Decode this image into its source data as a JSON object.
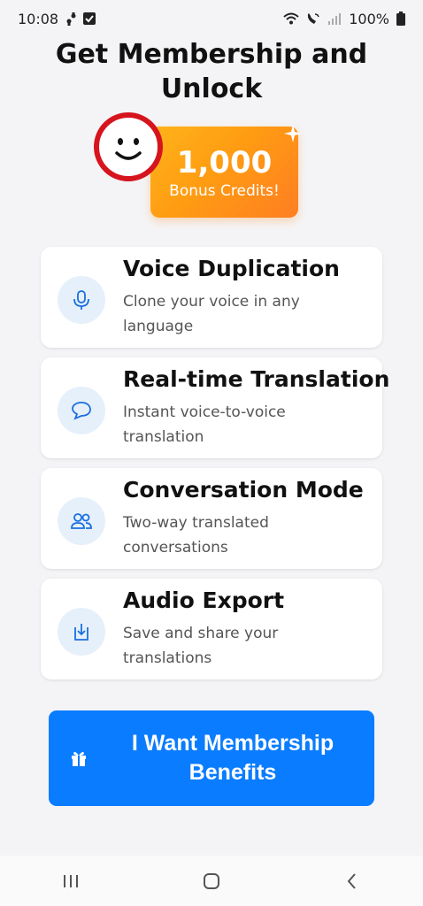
{
  "status_bar": {
    "time": "10:08",
    "battery": "100%",
    "icons": [
      "walk-icon",
      "check-box-icon",
      "wifi-icon",
      "wifi-calling-icon",
      "signal-icon",
      "battery-icon"
    ]
  },
  "title": "Get Membership and Unlock",
  "credits": {
    "amount": "1,000",
    "label": "Bonus Credits!"
  },
  "features": [
    {
      "title": "Voice Duplication",
      "description": "Clone your voice in any language",
      "icon": "microphone-icon"
    },
    {
      "title": "Real-time Translation",
      "description": "Instant voice-to-voice translation",
      "icon": "chat-bubble-icon"
    },
    {
      "title": "Conversation Mode",
      "description": "Two-way translated conversations",
      "icon": "people-icon"
    },
    {
      "title": "Audio Export",
      "description": "Save and share your translations",
      "icon": "download-icon"
    }
  ],
  "cta": {
    "label": "I Want Membership Benefits",
    "icon": "gift-icon"
  },
  "nav": {
    "icons": [
      "recent-apps-icon",
      "home-icon",
      "back-icon"
    ]
  },
  "colors": {
    "accent": "#0a7cff",
    "credit_gradient_start": "#ffb31a",
    "credit_gradient_end": "#ff7e22",
    "icon_bg": "#e6f0fb",
    "annotation_ring": "#d6141e"
  }
}
